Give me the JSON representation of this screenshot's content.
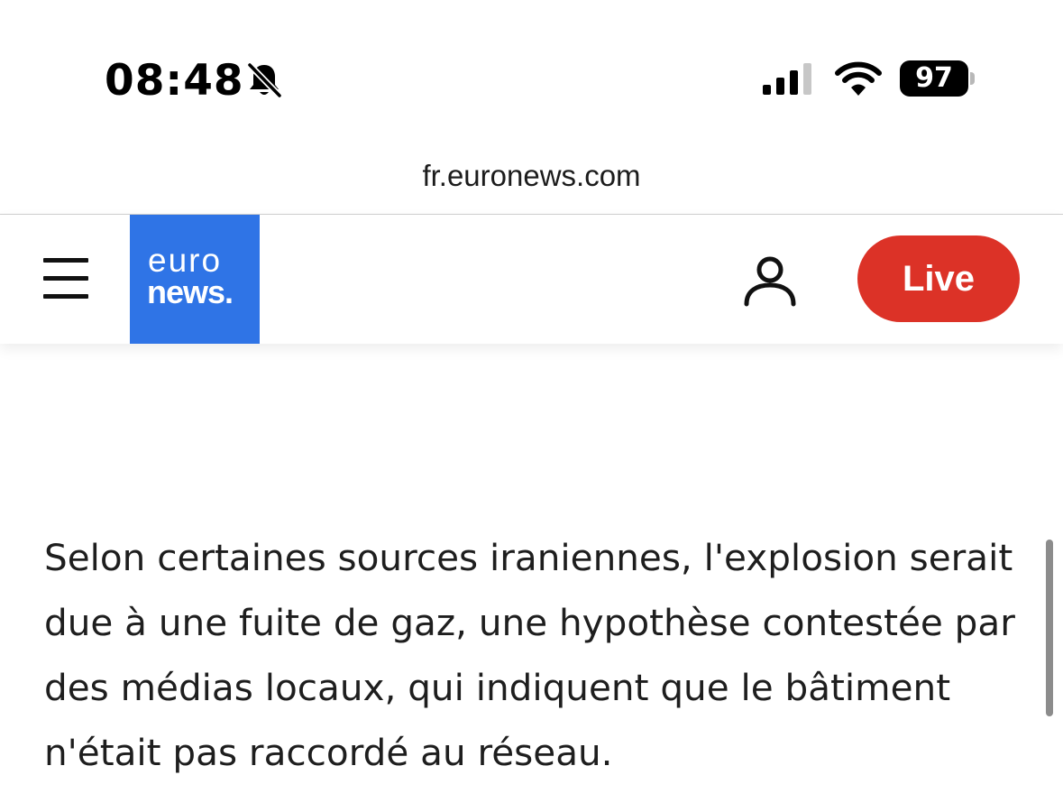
{
  "status_bar": {
    "time": "08:48",
    "battery": "97",
    "silent_icon": "bell-slash-icon",
    "signal_icon": "cellular-signal-icon",
    "wifi_icon": "wifi-icon"
  },
  "browser": {
    "url": "fr.euronews.com"
  },
  "header": {
    "menu_icon": "hamburger-menu-icon",
    "logo_top": "euro",
    "logo_bottom": "news.",
    "account_icon": "user-icon",
    "live_label": "Live",
    "brand_color": "#2f74e6",
    "live_color": "#dc3227"
  },
  "article": {
    "paragraph": "Selon certaines sources iraniennes, l'explosion serait due à une fuite de gaz, une hypothèse contestée par des médias locaux, qui indiquent que le bâtiment n'était pas raccordé au réseau."
  }
}
